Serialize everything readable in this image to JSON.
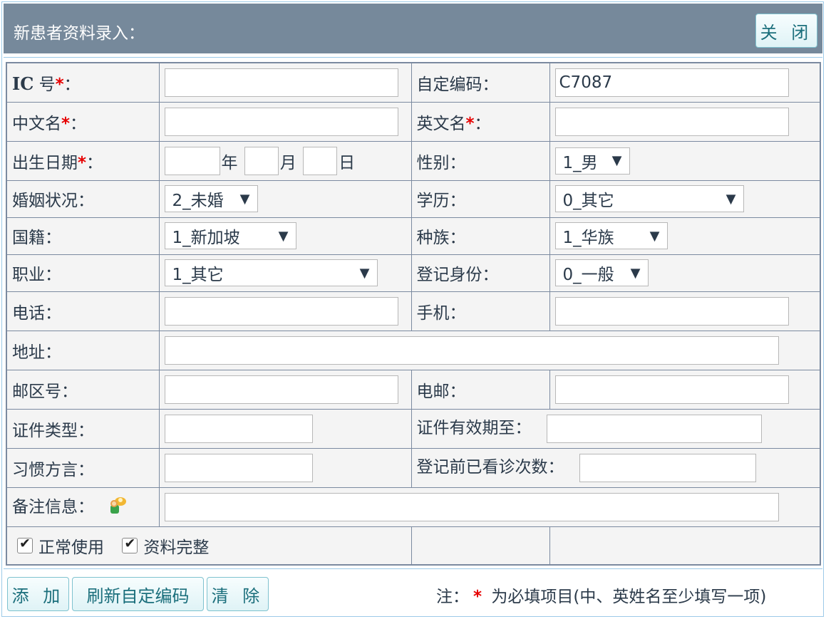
{
  "header": {
    "title": "新患者资料录入：",
    "close_label": "关 闭"
  },
  "form": {
    "ic_label": "IC",
    "ic_label_suffix": "号",
    "custom_code_label": "自定编码：",
    "custom_code_value": "C7087",
    "cn_name_label": "中文名",
    "en_name_label": "英文名",
    "birth_label": "出生日期",
    "birth_year_unit": "年",
    "birth_month_unit": "月",
    "birth_day_unit": "日",
    "gender_label": "性别：",
    "gender_value": "1_男",
    "marital_label": "婚姻状况：",
    "marital_value": "2_未婚",
    "education_label": "学历：",
    "education_value": "0_其它",
    "nationality_label": "国籍：",
    "nationality_value": "1_新加坡",
    "race_label": "种族：",
    "race_value": "1_华族",
    "occupation_label": "职业：",
    "occupation_value": "1_其它",
    "reg_identity_label": "登记身份：",
    "reg_identity_value": "0_一般",
    "phone_label": "电话：",
    "mobile_label": "手机：",
    "address_label": "地址：",
    "postal_label": "邮区号：",
    "email_label": "电邮：",
    "id_type_label": "证件类型：",
    "id_expiry_label": "证件有效期至：",
    "dialect_label": "习惯方言：",
    "prior_visits_label": "登记前已看诊次数：",
    "memo_label": "备注信息：",
    "active_label": "正常使用",
    "complete_label": "资料完整",
    "required_mark": "*",
    "colon": "："
  },
  "footer": {
    "add_label": "添 加",
    "refresh_code_label": "刷新自定编码",
    "clear_label": "清 除",
    "note_prefix": "注：",
    "note_star": "*",
    "note_text": " 为必填项目(中、英姓名至少填写一项)"
  },
  "colors": {
    "header_bg": "#76899b",
    "accent_button_text": "#1b6f7c",
    "required_red": "#e60000",
    "cell_bg": "#f4f4f4"
  }
}
